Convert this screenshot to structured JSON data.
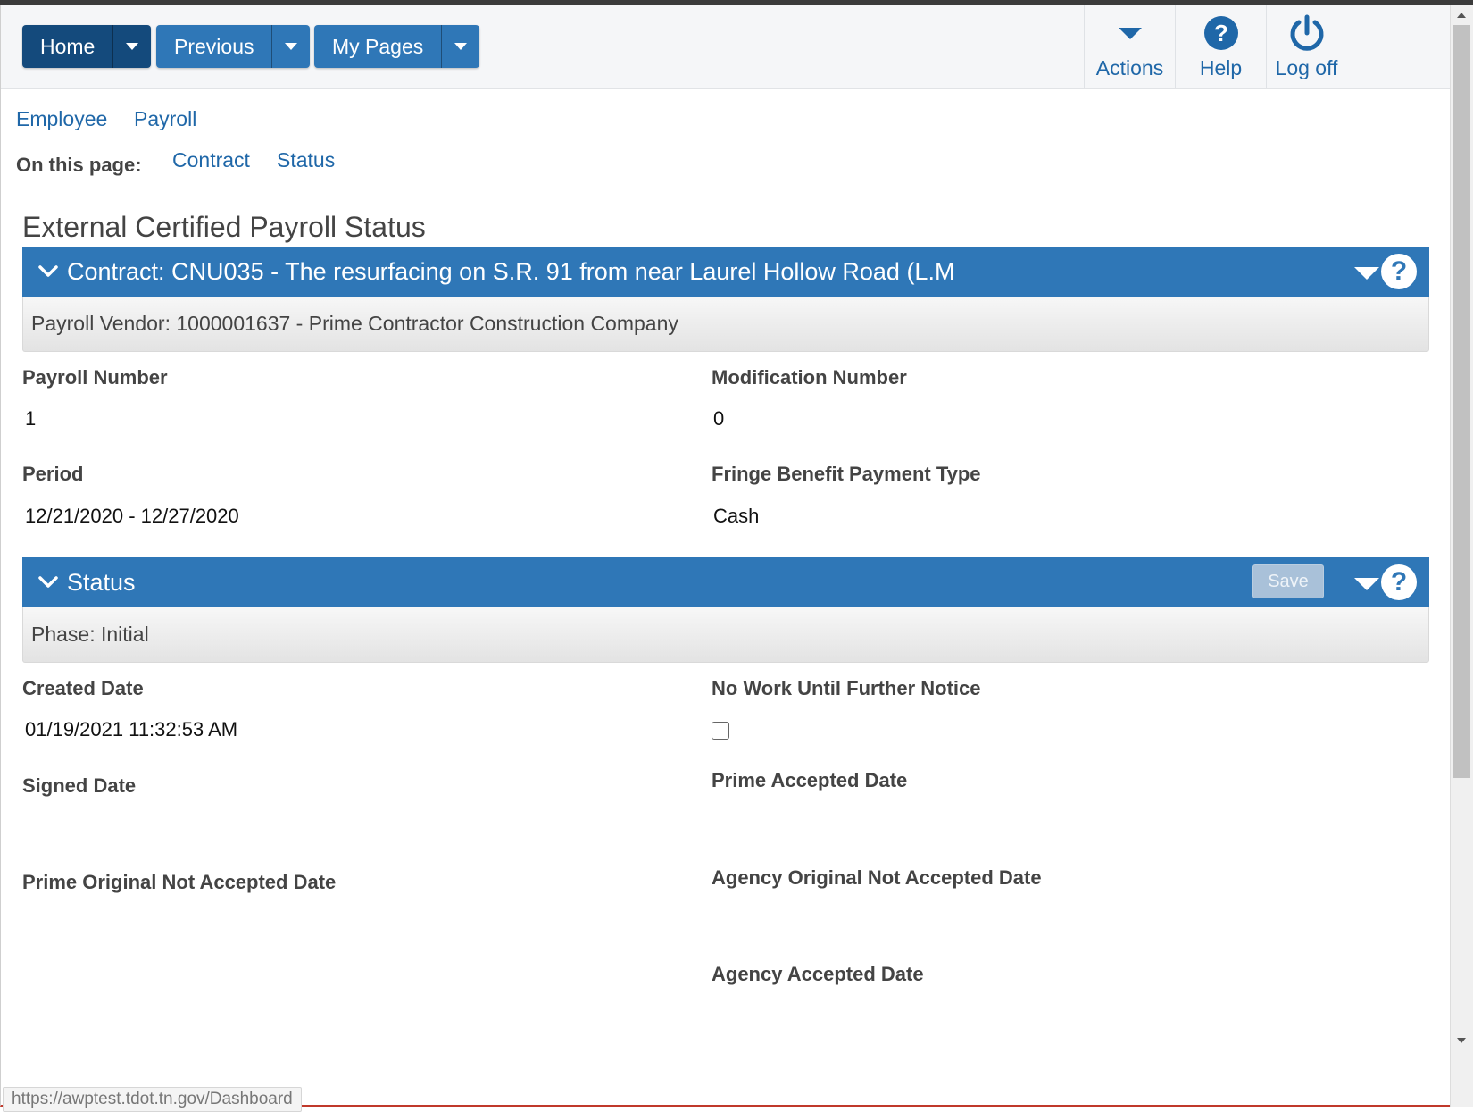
{
  "nav": {
    "home": "Home",
    "previous": "Previous",
    "my_pages": "My Pages",
    "actions": "Actions",
    "help": "Help",
    "log_off": "Log off"
  },
  "breadcrumb": {
    "employee": "Employee",
    "payroll": "Payroll"
  },
  "on_this_page": {
    "label": "On this page:",
    "contract": "Contract",
    "status": "Status"
  },
  "page_title": "External Certified Payroll Status",
  "contract_panel": {
    "title": "Contract: CNU035 - The resurfacing on S.R. 91 from near Laurel Hollow Road (L.M",
    "subtitle": "Payroll Vendor: 1000001637 - Prime Contractor Construction Company",
    "fields": {
      "payroll_number_label": "Payroll Number",
      "payroll_number": "1",
      "modification_number_label": "Modification Number",
      "modification_number": "0",
      "period_label": "Period",
      "period": "12/21/2020 - 12/27/2020",
      "fringe_label": "Fringe Benefit Payment Type",
      "fringe": "Cash"
    }
  },
  "status_panel": {
    "title": "Status",
    "save_label": "Save",
    "subtitle": "Phase: Initial",
    "fields": {
      "created_date_label": "Created Date",
      "created_date": "01/19/2021 11:32:53 AM",
      "no_work_label": "No Work Until Further Notice",
      "no_work_checked": false,
      "signed_date_label": "Signed Date",
      "prime_accepted_label": "Prime Accepted Date",
      "prime_original_not_accepted_label": "Prime Original Not Accepted Date",
      "agency_original_not_accepted_label": "Agency Original Not Accepted Date",
      "agency_accepted_label": "Agency Accepted Date"
    }
  },
  "status_bar_url": "https://awptest.tdot.tn.gov/Dashboard",
  "colors": {
    "primary": "#2f77b7",
    "home": "#144a7c",
    "link": "#1f67a8"
  }
}
